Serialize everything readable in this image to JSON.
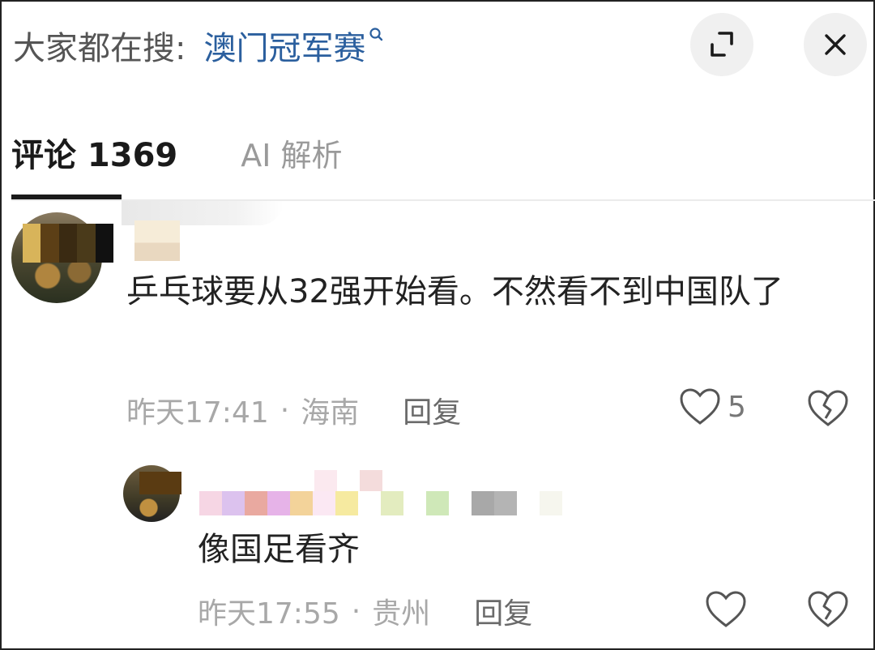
{
  "search": {
    "prefix": "大家都在搜:",
    "term": "澳门冠军赛"
  },
  "tabs": {
    "comments_label": "评论 1369",
    "ai_label": "AI 解析"
  },
  "comments": [
    {
      "text": "乒乓球要从32强开始看。不然看不到中国队了",
      "time": "昨天17:41",
      "location": "海南",
      "reply_label": "回复",
      "like_count": "5"
    }
  ],
  "replies": [
    {
      "text": "像国足看齐",
      "time": "昨天17:55",
      "location": "贵州",
      "reply_label": "回复"
    }
  ],
  "icons": {
    "search": "search-icon",
    "expand": "expand-icon",
    "close": "close-icon",
    "like": "heart-outline-icon",
    "dislike": "broken-heart-icon"
  },
  "colors": {
    "search_term": "#2b5f9e",
    "meta_text": "#a8a8a8",
    "tab_inactive": "#9a9a9a"
  }
}
